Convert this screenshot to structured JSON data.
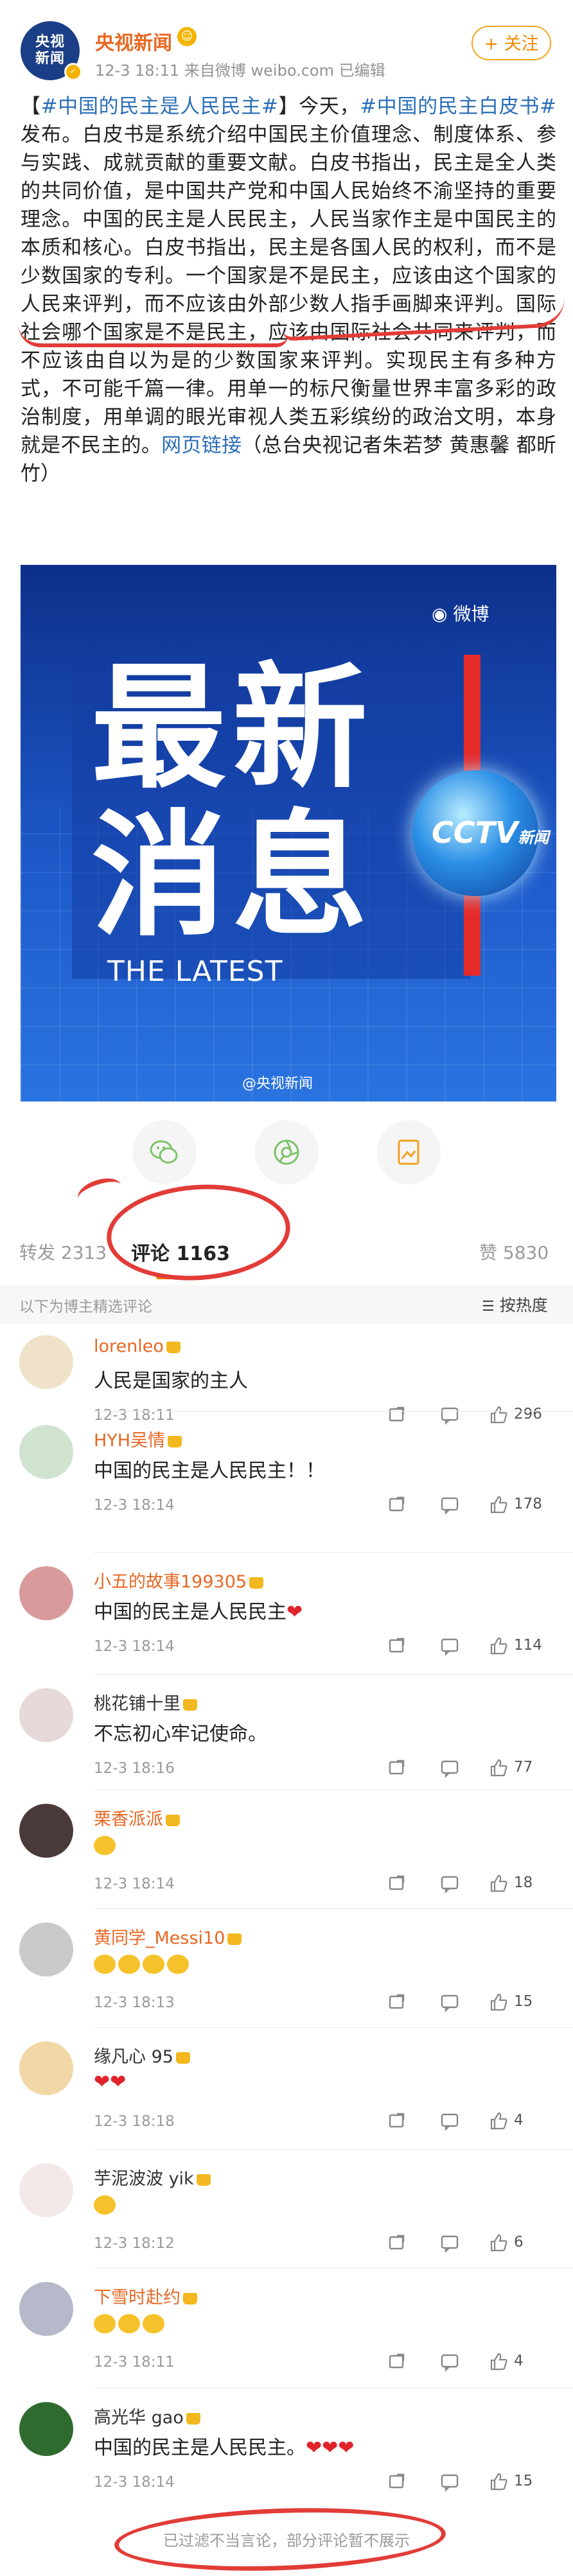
{
  "post": {
    "author": "央视新闻",
    "avatar_text_1": "央视",
    "avatar_text_2": "新闻",
    "meta": "12-3 18:11  来自微博 weibo.com  已编辑",
    "follow_label": "+ 关注",
    "text_segments": [
      {
        "t": "【",
        "hl": false
      },
      {
        "t": "#中国的民主是人民民主#",
        "hl": true
      },
      {
        "t": "】今天，",
        "hl": false
      },
      {
        "t": "#中国的民主白皮书#",
        "hl": true
      },
      {
        "t": "发布。白皮书是系统介绍中国民主价值理念、制度体系、参与实践、成就贡献的重要文献。白皮书指出，民主是全人类的共同价值，是中国共产党和中国人民始终不渝坚持的重要理念。中国的民主是人民民主，人民当家作主是中国民主的本质和核心。白皮书指出，民主是各国人民的权利，而不是少数国家的专利。一个国家是不是民主，应该由这个国家的人民来评判，而不应该由外部少数人指手画脚来评判。国际社会哪个国家是不是民主，应该由国际社会共同来评判，而不应该由自以为是的少数国家来评判。实现民主有多种方式，不可能千篇一律。用单一的标尺衡量世界丰富多彩的政治制度，用单调的眼光审视人类五彩缤纷的政治文明，本身就是不民主的。",
        "hl": false
      },
      {
        "t": "网页链接",
        "hl": true
      },
      {
        "t": "（总台央视记者朱若梦 黄惠馨 都昕竹）",
        "hl": false
      }
    ],
    "image": {
      "big_line_1": "最新",
      "big_line_2": "消息",
      "subtitle": "THE LATEST",
      "logo": "CCTV",
      "logo_suffix": "新闻",
      "watermark_top": "微博",
      "watermark_bottom": "@央视新闻"
    }
  },
  "tabs": {
    "repost": "转发 2313",
    "comments": "评论 1163",
    "likes": "赞 5830"
  },
  "subheader": {
    "note": "以下为博主精选评论",
    "sort_label": "按热度"
  },
  "comments": [
    {
      "name": "lorenleo",
      "text": "人民是国家的主人",
      "time": "12-3 18:11",
      "likes": "296"
    },
    {
      "name": "HYH吴情",
      "text": "中国的民主是人民民主！！",
      "time": "12-3 18:14",
      "likes": "178"
    },
    {
      "name": "小五的故事199305",
      "text": "中国的民主是人民民主",
      "time": "12-3 18:14",
      "likes": "114"
    },
    {
      "name": "桃花铺十里",
      "text": "不忘初心牢记使命。",
      "time": "12-3 18:16",
      "likes": "77"
    },
    {
      "name": "栗香派派",
      "text": "",
      "time": "12-3 18:14",
      "likes": "18"
    },
    {
      "name": "黄同学_Messi10",
      "text": "",
      "time": "12-3 18:13",
      "likes": "15"
    },
    {
      "name": "缘凡心 95",
      "text": "",
      "time": "12-3 18:18",
      "likes": "4"
    },
    {
      "name": "芋泥波波 yik",
      "text": "",
      "time": "12-3 18:12",
      "likes": "6"
    },
    {
      "name": "下雪时赴约",
      "text": "",
      "time": "12-3 18:11",
      "likes": "4"
    },
    {
      "name": "高光华 gao",
      "text": "中国的民主是人民民主。",
      "time": "12-3 18:14",
      "likes": "15"
    }
  ],
  "filter_note": "已过滤不当言论，部分评论暂不展示",
  "colors": {
    "accent_orange": "#e86722",
    "link_blue": "#2c6fb7",
    "annotation_red": "#e23c37"
  }
}
